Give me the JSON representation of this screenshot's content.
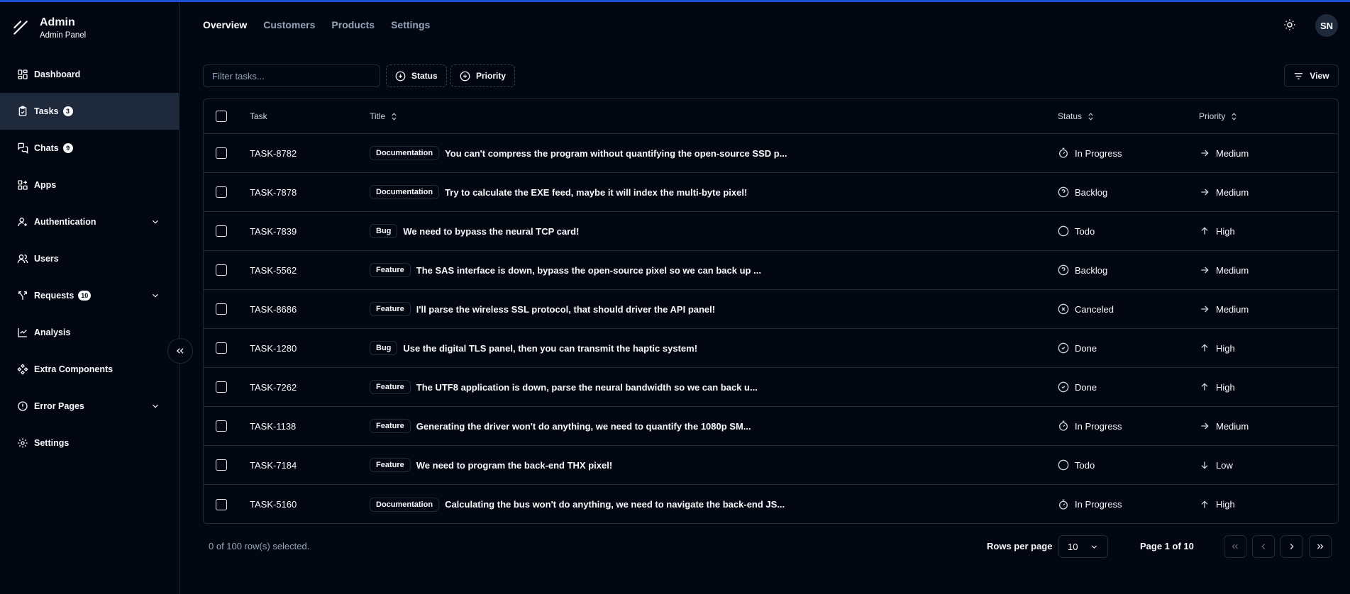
{
  "brand": {
    "title": "Admin",
    "subtitle": "Admin Panel"
  },
  "sidebar": {
    "items": [
      {
        "label": "Dashboard",
        "icon": "dashboard-icon"
      },
      {
        "label": "Tasks",
        "icon": "clipboard-icon",
        "badge": "3",
        "active": true
      },
      {
        "label": "Chats",
        "icon": "chat-icon",
        "badge": "9"
      },
      {
        "label": "Apps",
        "icon": "apps-icon"
      },
      {
        "label": "Authentication",
        "icon": "user-icon",
        "expandable": true
      },
      {
        "label": "Users",
        "icon": "users-icon"
      },
      {
        "label": "Requests",
        "icon": "requests-icon",
        "badge": "10",
        "expandable": true
      },
      {
        "label": "Analysis",
        "icon": "chart-icon"
      },
      {
        "label": "Extra Components",
        "icon": "components-icon"
      },
      {
        "label": "Error Pages",
        "icon": "error-icon",
        "expandable": true
      },
      {
        "label": "Settings",
        "icon": "gear-icon"
      }
    ]
  },
  "topnav": {
    "tabs": [
      "Overview",
      "Customers",
      "Products",
      "Settings"
    ],
    "active": "Overview"
  },
  "header": {
    "avatar": "SN"
  },
  "toolbar": {
    "filter_placeholder": "Filter tasks...",
    "status_label": "Status",
    "priority_label": "Priority",
    "view_label": "View"
  },
  "table": {
    "headers": {
      "task": "Task",
      "title": "Title",
      "status": "Status",
      "priority": "Priority"
    },
    "rows": [
      {
        "id": "TASK-8782",
        "label": "Documentation",
        "title": "You can't compress the program without quantifying the open-source SSD p...",
        "status": "In Progress",
        "priority": "Medium"
      },
      {
        "id": "TASK-7878",
        "label": "Documentation",
        "title": "Try to calculate the EXE feed, maybe it will index the multi-byte pixel!",
        "status": "Backlog",
        "priority": "Medium"
      },
      {
        "id": "TASK-7839",
        "label": "Bug",
        "title": "We need to bypass the neural TCP card!",
        "status": "Todo",
        "priority": "High"
      },
      {
        "id": "TASK-5562",
        "label": "Feature",
        "title": "The SAS interface is down, bypass the open-source pixel so we can back up ...",
        "status": "Backlog",
        "priority": "Medium"
      },
      {
        "id": "TASK-8686",
        "label": "Feature",
        "title": "I'll parse the wireless SSL protocol, that should driver the API panel!",
        "status": "Canceled",
        "priority": "Medium"
      },
      {
        "id": "TASK-1280",
        "label": "Bug",
        "title": "Use the digital TLS panel, then you can transmit the haptic system!",
        "status": "Done",
        "priority": "High"
      },
      {
        "id": "TASK-7262",
        "label": "Feature",
        "title": "The UTF8 application is down, parse the neural bandwidth so we can back u...",
        "status": "Done",
        "priority": "High"
      },
      {
        "id": "TASK-1138",
        "label": "Feature",
        "title": "Generating the driver won't do anything, we need to quantify the 1080p SM...",
        "status": "In Progress",
        "priority": "Medium"
      },
      {
        "id": "TASK-7184",
        "label": "Feature",
        "title": "We need to program the back-end THX pixel!",
        "status": "Todo",
        "priority": "Low"
      },
      {
        "id": "TASK-5160",
        "label": "Documentation",
        "title": "Calculating the bus won't do anything, we need to navigate the back-end JS...",
        "status": "In Progress",
        "priority": "High"
      }
    ]
  },
  "footer": {
    "selected": "0 of 100 row(s) selected.",
    "rows_per_page_label": "Rows per page",
    "rows_per_page_value": "10",
    "page_label": "Page 1 of 10"
  }
}
